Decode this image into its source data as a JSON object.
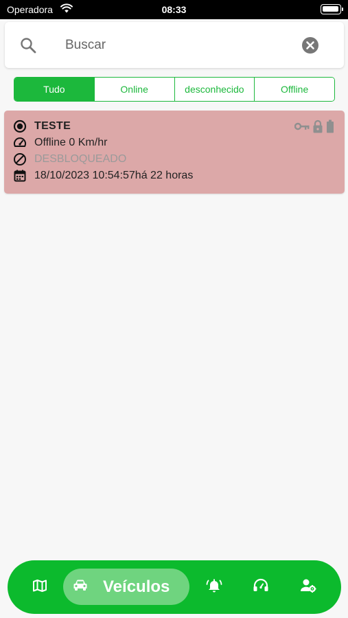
{
  "status_bar": {
    "carrier": "Operadora",
    "time": "08:33"
  },
  "search": {
    "placeholder": "Buscar"
  },
  "filters": [
    {
      "label": "Tudo",
      "active": true
    },
    {
      "label": "Online",
      "active": false
    },
    {
      "label": "desconhecido",
      "active": false
    },
    {
      "label": "Offline",
      "active": false
    }
  ],
  "vehicle": {
    "name": "TESTE",
    "speed_status": "Offline 0 Km/hr",
    "lock_status": "DESBLOQUEADO",
    "last_update": "18/10/2023 10:54:57há 22 horas",
    "card_color": "#dca8a8"
  },
  "bottom_nav": {
    "active_label": "Veículos",
    "items": [
      "map-icon",
      "car-icon",
      "bell-icon",
      "support-icon",
      "user-settings-icon"
    ],
    "color": "#0cba2d"
  }
}
